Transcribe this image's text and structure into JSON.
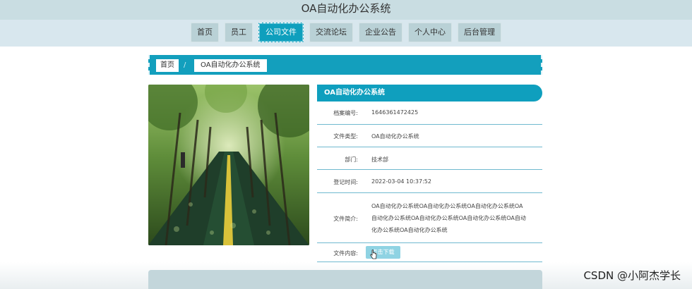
{
  "app": {
    "title": "OA自动化办公系统"
  },
  "nav": {
    "items": [
      {
        "label": "首页"
      },
      {
        "label": "员工"
      },
      {
        "label": "公司文件",
        "active": true
      },
      {
        "label": "交流论坛"
      },
      {
        "label": "企业公告"
      },
      {
        "label": "个人中心"
      },
      {
        "label": "后台管理"
      }
    ]
  },
  "breadcrumb": {
    "home": "首页",
    "current": "OA自动化办公系统"
  },
  "detail": {
    "heading": "OA自动化办公系统",
    "rows": [
      {
        "label": "档案编号:",
        "value": "1646361472425"
      },
      {
        "label": "文件类型:",
        "value": "OA自动化办公系统"
      },
      {
        "label": "部门:",
        "value": "技术部"
      },
      {
        "label": "登记时间:",
        "value": "2022-03-04 10:37:52"
      },
      {
        "label": "文件简介:",
        "value": "OA自动化办公系统OA自动化办公系统OA自动化办公系统OA自动化办公系统OA自动化办公系统OA自动化办公系统OA自动化办公系统OA自动化办公系统"
      },
      {
        "label": "文件内容:",
        "value": ""
      }
    ],
    "download_label": "点击下载"
  },
  "watermark": "CSDN @小阿杰学长",
  "colors": {
    "accent": "#0f9fbe",
    "nav_bg": "#b9d1d6",
    "header_bg": "#c9dde2"
  }
}
